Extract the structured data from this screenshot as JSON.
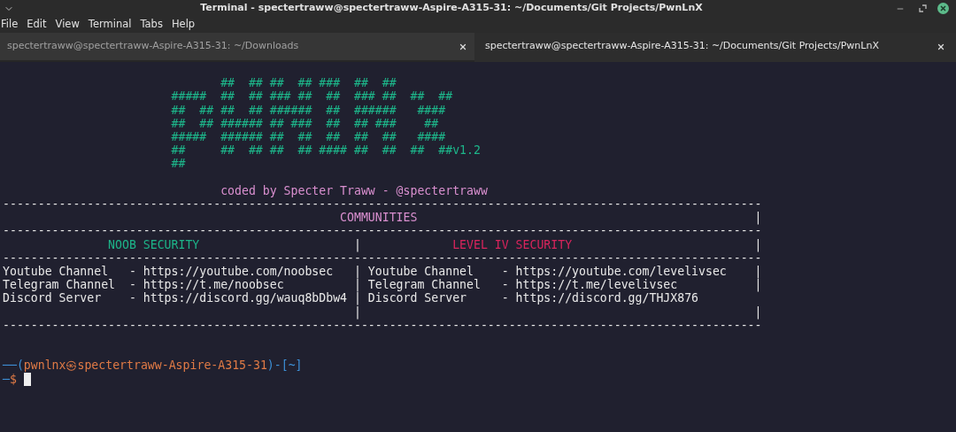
{
  "window": {
    "title": "Terminal - spectertraww@spectertraww-Aspire-A315-31: ~/Documents/Git Projects/PwnLnX"
  },
  "menu": [
    "File",
    "Edit",
    "View",
    "Terminal",
    "Tabs",
    "Help"
  ],
  "tabs": [
    {
      "label": "spectertraww@spectertraww-Aspire-A315-31: ~/Downloads",
      "selected": false
    },
    {
      "label": "spectertraww@spectertraww-Aspire-A315-31: ~/Documents/Git Projects/PwnLnX",
      "selected": true
    }
  ],
  "terminal": {
    "lines": [
      {
        "kind": "blank"
      },
      {
        "kind": "text",
        "segments": [
          {
            "text": "                               ##  ## ##  ## ###  ##  ##",
            "color": "#1db489"
          }
        ]
      },
      {
        "kind": "text",
        "segments": [
          {
            "text": "                        #####  ##  ## ### ##  ##  ### ##  ##  ##",
            "color": "#1db489"
          }
        ]
      },
      {
        "kind": "text",
        "segments": [
          {
            "text": "                        ##  ## ##  ## ######  ##  ######   ####",
            "color": "#1db489"
          }
        ]
      },
      {
        "kind": "text",
        "segments": [
          {
            "text": "                        ##  ## ###### ## ###  ##  ## ###    ##",
            "color": "#1db489"
          }
        ]
      },
      {
        "kind": "text",
        "segments": [
          {
            "text": "                        #####  ###### ##  ##  ##  ##  ##   ####",
            "color": "#1db489"
          }
        ]
      },
      {
        "kind": "text",
        "segments": [
          {
            "text": "                        ##     ##  ## ##  ## #### ##  ##  ##  ##v1.2",
            "color": "#1db489"
          }
        ]
      },
      {
        "kind": "text",
        "segments": [
          {
            "text": "                        ##",
            "color": "#1db489"
          }
        ]
      },
      {
        "kind": "blank"
      },
      {
        "kind": "text",
        "segments": [
          {
            "text": "                               coded by Specter Traww - @spectertraww",
            "color": "#d98fcf"
          }
        ]
      },
      {
        "kind": "text",
        "segments": [
          {
            "text": "------------------------------------------------------------------------------------------------------------"
          }
        ]
      },
      {
        "kind": "text",
        "segments": [
          {
            "text": "                                                COMMUNITIES",
            "color": "#d98fcf"
          },
          {
            "text": "                                                |"
          }
        ]
      },
      {
        "kind": "text",
        "segments": [
          {
            "text": "------------------------------------------------------------------------------------------------------------"
          }
        ]
      },
      {
        "kind": "text",
        "segments": [
          {
            "text": "               NOOB SECURITY",
            "color": "#1db489"
          },
          {
            "text": "                      |             "
          },
          {
            "text": "LEVEL IV SECURITY",
            "color": "#d9245c"
          },
          {
            "text": "                          |"
          }
        ]
      },
      {
        "kind": "text",
        "segments": [
          {
            "text": "------------------------------------------------------------------------------------------------------------"
          }
        ]
      },
      {
        "kind": "text",
        "segments": [
          {
            "text": "Youtube Channel   - https://youtube.com/noobsec   | Youtube Channel    - https://youtube.com/levelivsec    |"
          }
        ]
      },
      {
        "kind": "text",
        "segments": [
          {
            "text": "Telegram Channel  - https://t.me/noobsec          | Telegram Channel   - https://t.me/levelivsec           |"
          }
        ]
      },
      {
        "kind": "text",
        "segments": [
          {
            "text": "Discord Server    - https://discord.gg/wauq8bDbw4 | Discord Server     - https://discord.gg/THJX876"
          }
        ]
      },
      {
        "kind": "text",
        "segments": [
          {
            "text": "                                                  |                                                        |"
          }
        ]
      },
      {
        "kind": "text",
        "segments": [
          {
            "text": "------------------------------------------------------------------------------------------------------------"
          }
        ]
      },
      {
        "kind": "blank"
      },
      {
        "kind": "blank"
      },
      {
        "kind": "text",
        "segments": [
          {
            "text": "──(",
            "color": "#3d8fd6"
          },
          {
            "text": "pwnlnx㉿spectertraww-Aspire-A315-31",
            "color": "#e07a45"
          },
          {
            "text": ")-[~]",
            "color": "#3d8fd6"
          }
        ]
      },
      {
        "kind": "prompt",
        "cursor": true,
        "segments": [
          {
            "text": "─",
            "color": "#3d8fd6"
          },
          {
            "text": "$",
            "color": "#e07a45"
          }
        ]
      }
    ]
  }
}
